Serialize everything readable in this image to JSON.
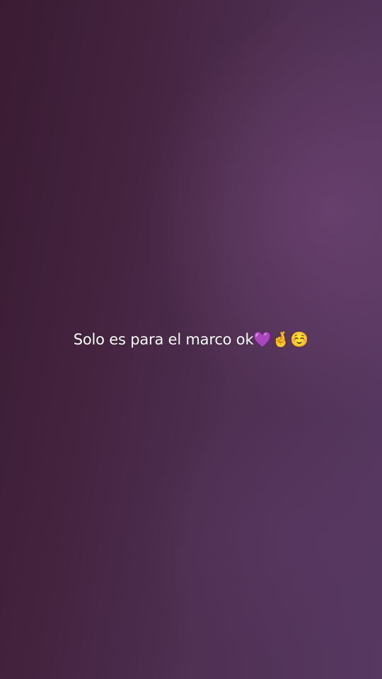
{
  "story": {
    "caption": "Solo es para el marco ok💜🤞☺️"
  },
  "colors": {
    "background_dark": "#3a1b33",
    "background_light": "#573861",
    "caption_text": "#ffffff"
  }
}
